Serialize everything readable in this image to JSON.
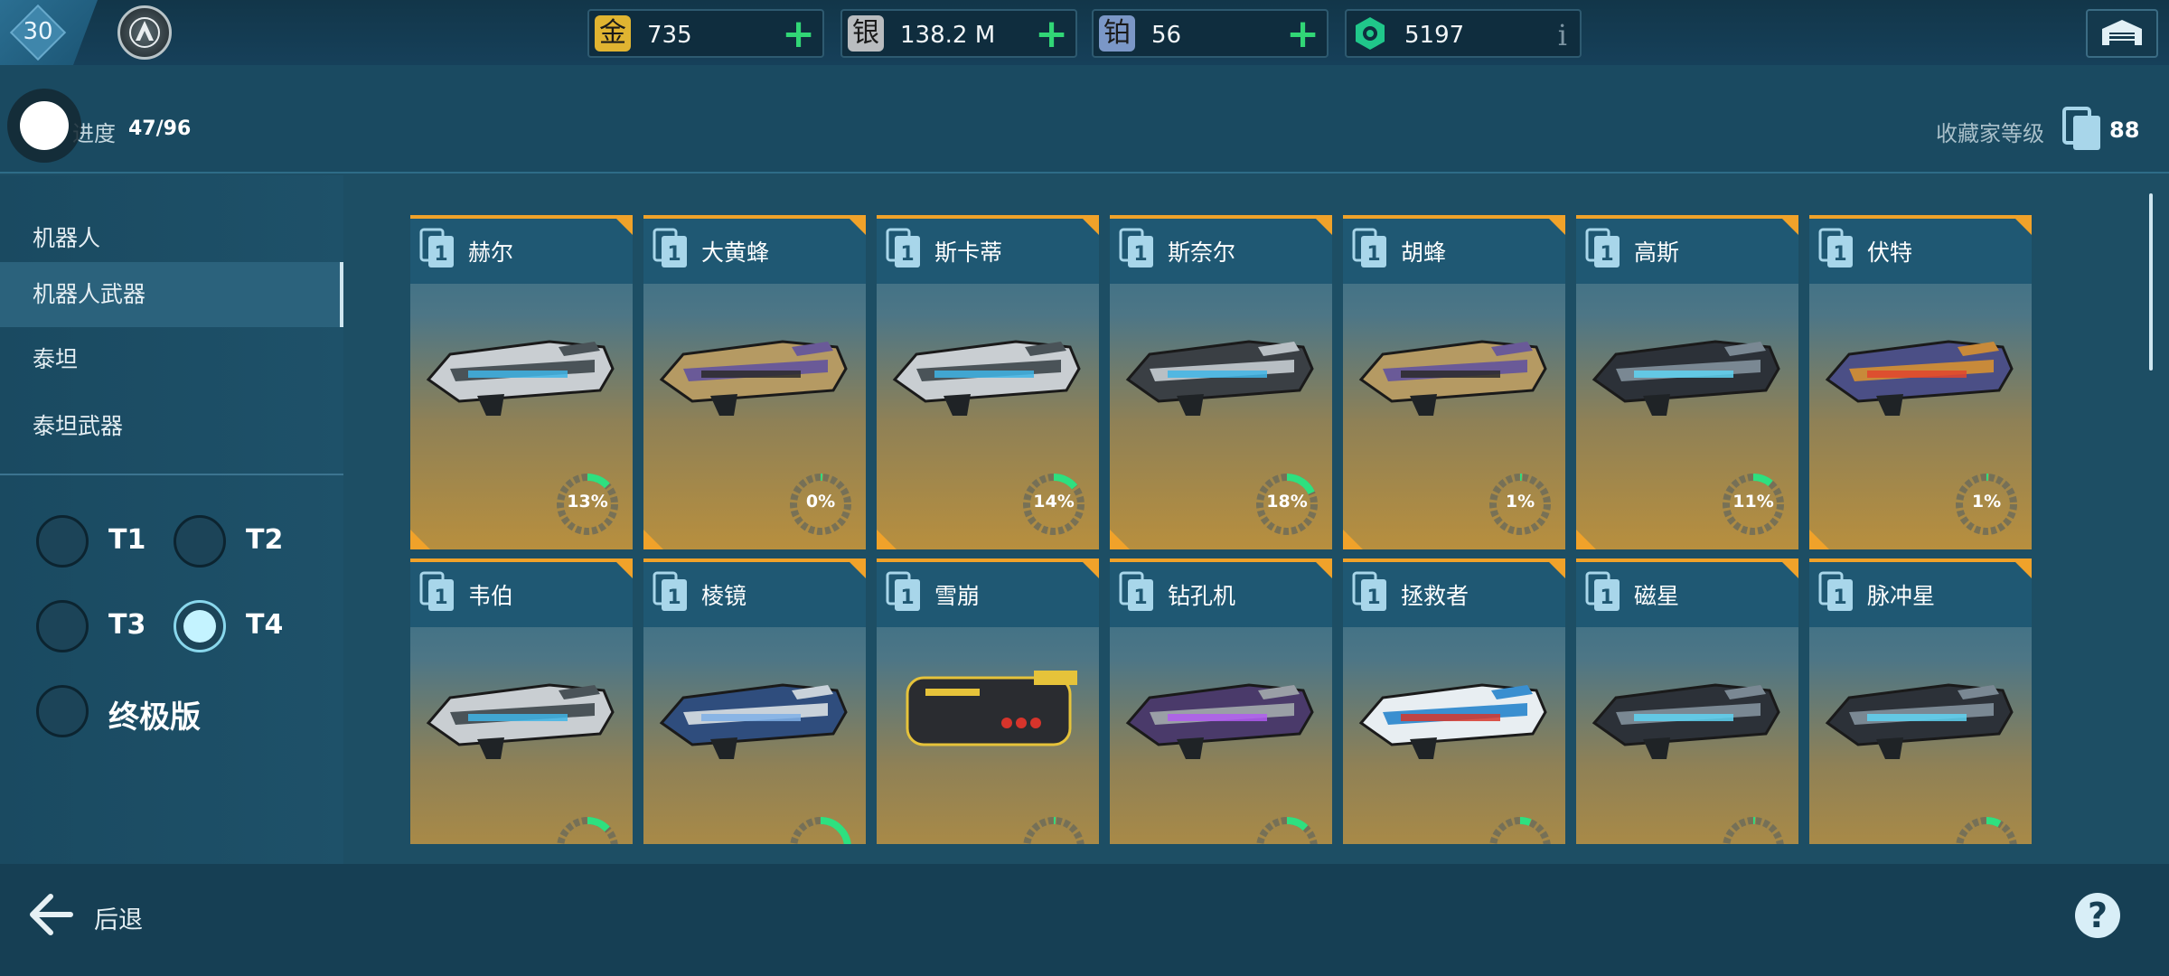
{
  "player": {
    "level": "30"
  },
  "currencies": [
    {
      "id": "gold",
      "glyph": "金",
      "value": "735",
      "color": "#e0b431",
      "has_plus": true
    },
    {
      "id": "silver",
      "glyph": "银",
      "value": "138.2 M",
      "color": "#b9bcbf",
      "has_plus": true
    },
    {
      "id": "platinum",
      "glyph": "铂",
      "value": "56",
      "color": "#7b97c7",
      "has_plus": true
    },
    {
      "id": "key",
      "glyph": "",
      "value": "5197",
      "color": "#20c78a",
      "has_plus": false,
      "info": "i"
    }
  ],
  "collection": {
    "progress_label": "进度",
    "progress_value": "47/96",
    "collector_label": "收藏家等级",
    "collector_level": "88"
  },
  "sidebar": {
    "items": [
      {
        "label": "机器人",
        "active": false
      },
      {
        "label": "机器人武器",
        "active": true
      },
      {
        "label": "泰坦",
        "active": false
      },
      {
        "label": "泰坦武器",
        "active": false
      }
    ],
    "tiers": [
      {
        "label": "T1",
        "selected": false
      },
      {
        "label": "T2",
        "selected": false
      },
      {
        "label": "T3",
        "selected": false
      },
      {
        "label": "T4",
        "selected": true
      },
      {
        "label": "终极版",
        "selected": false
      }
    ]
  },
  "weapons": [
    {
      "name": "赫尔",
      "tier": "1",
      "percent": 13,
      "percent_label": "13%",
      "art": "silver"
    },
    {
      "name": "大黄蜂",
      "tier": "1",
      "percent": 0,
      "percent_label": "0%",
      "art": "camo"
    },
    {
      "name": "斯卡蒂",
      "tier": "1",
      "percent": 14,
      "percent_label": "14%",
      "art": "silver"
    },
    {
      "name": "斯奈尔",
      "tier": "1",
      "percent": 18,
      "percent_label": "18%",
      "art": "dark"
    },
    {
      "name": "胡蜂",
      "tier": "1",
      "percent": 1,
      "percent_label": "1%",
      "art": "camo"
    },
    {
      "name": "高斯",
      "tier": "1",
      "percent": 11,
      "percent_label": "11%",
      "art": "rail"
    },
    {
      "name": "伏特",
      "tier": "1",
      "percent": 1,
      "percent_label": "1%",
      "art": "volt"
    },
    {
      "name": "韦伯",
      "tier": "1",
      "percent": 13,
      "percent_label": "",
      "art": "silver"
    },
    {
      "name": "棱镜",
      "tier": "1",
      "percent": 28,
      "percent_label": "",
      "art": "blue"
    },
    {
      "name": "雪崩",
      "tier": "1",
      "percent": 0,
      "percent_label": "",
      "art": "box"
    },
    {
      "name": "钻孔机",
      "tier": "1",
      "percent": 12,
      "percent_label": "",
      "art": "purple"
    },
    {
      "name": "拯救者",
      "tier": "1",
      "percent": 6,
      "percent_label": "",
      "art": "white"
    },
    {
      "name": "磁星",
      "tier": "1",
      "percent": 0,
      "percent_label": "",
      "art": "rail"
    },
    {
      "name": "脉冲星",
      "tier": "1",
      "percent": 8,
      "percent_label": "",
      "art": "rail"
    }
  ],
  "footer": {
    "back_label": "后退",
    "help_label": "?"
  },
  "colors": {
    "accent_orange": "#f0a22a",
    "ring_green": "#2ee07f",
    "plus_green": "#31d676"
  }
}
